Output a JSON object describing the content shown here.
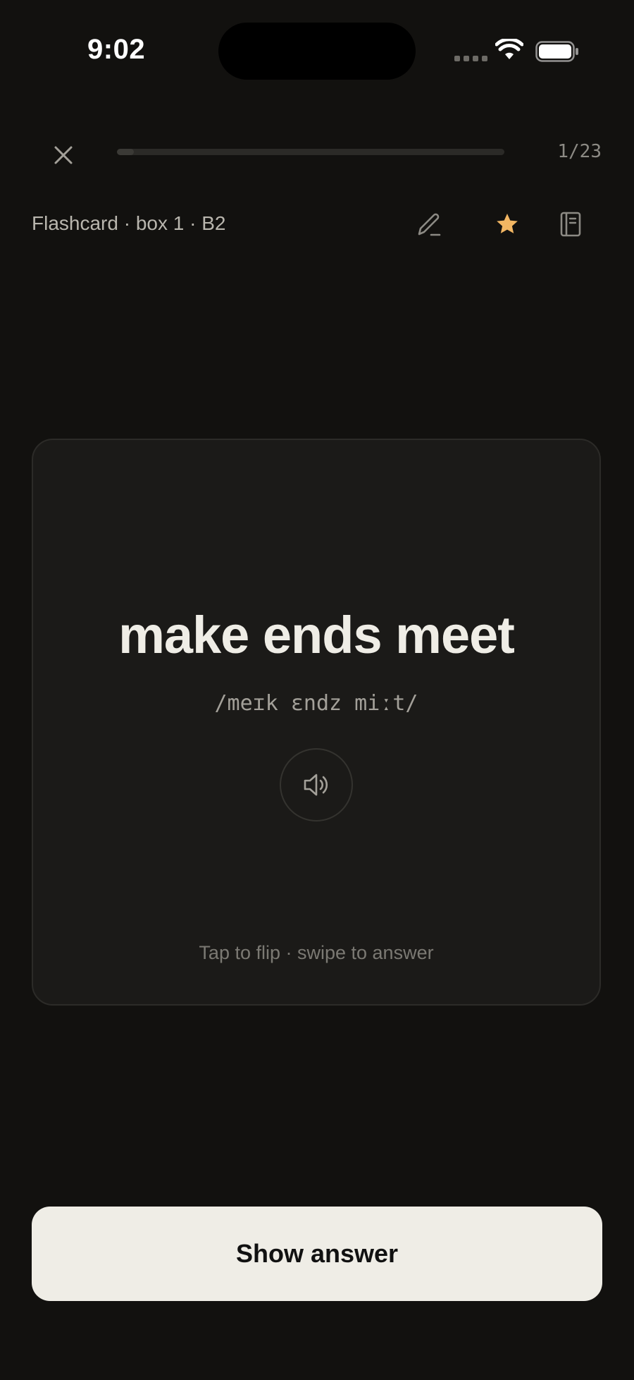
{
  "status_bar": {
    "time": "9:02"
  },
  "session": {
    "progress_counter": "1/23",
    "progress_fraction": 0.043
  },
  "meta": {
    "label": "Flashcard · box 1 · B2",
    "star_color": "#f2b663"
  },
  "card": {
    "word": "make ends meet",
    "ipa": "/meɪk ɛndz miːt/",
    "hint": "Tap to flip · swipe to answer"
  },
  "actions": {
    "show_answer_label": "Show answer"
  },
  "icons": {
    "close": "close-icon",
    "edit": "pencil-icon",
    "favorite": "star-icon",
    "notebook": "notebook-icon",
    "audio": "speaker-icon",
    "wifi": "wifi-icon",
    "battery": "battery-icon"
  }
}
